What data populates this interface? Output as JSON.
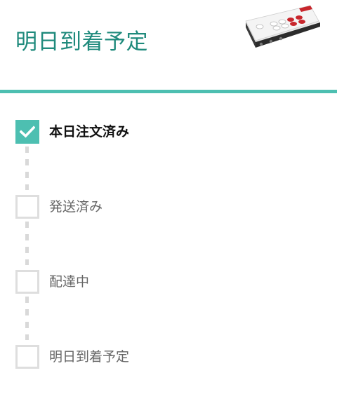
{
  "header": {
    "title": "明日到着予定",
    "product_image": "arcade-controller-image"
  },
  "colors": {
    "accent": "#4dbfb1",
    "title": "#1f8a7c",
    "pending_border": "#dedede"
  },
  "steps": [
    {
      "label": "本日注文済み",
      "status": "completed",
      "icon": "check-icon"
    },
    {
      "label": "発送済み",
      "status": "pending",
      "icon": "empty-checkbox"
    },
    {
      "label": "配達中",
      "status": "pending",
      "icon": "empty-checkbox"
    },
    {
      "label": "明日到着予定",
      "status": "pending",
      "icon": "empty-checkbox"
    }
  ]
}
